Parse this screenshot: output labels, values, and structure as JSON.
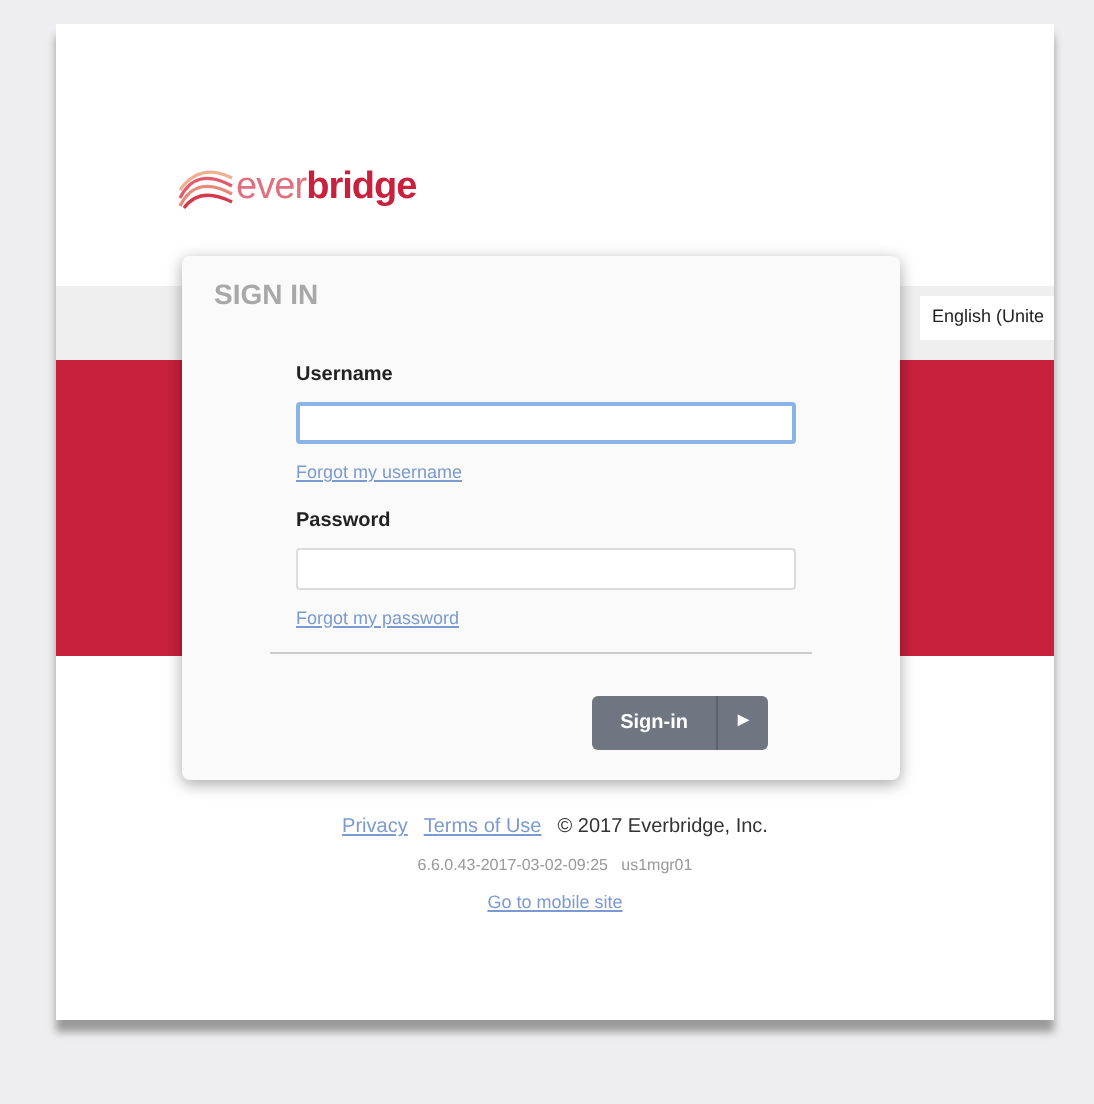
{
  "logo": {
    "text": "ever**bridge**"
  },
  "language": {
    "value": "English (Unite"
  },
  "sign_in": {
    "title": "SIGN IN",
    "username": {
      "label": "Username",
      "focused": true
    },
    "forgot_username": "Forgot my username",
    "password": {
      "label": "Password",
      "focused": false
    },
    "forgot_password": "Forgot my password",
    "button": {
      "label": "Sign-in",
      "arrow": "▶"
    }
  },
  "footer": {
    "links": [
      "Privacy",
      "Terms of Use"
    ],
    "copyright": "© 2017 Everbridge, Inc.",
    "version": "6.6.0.43-2017-03-02-09:25   us1mgr01",
    "mobile_link": "Go to mobile site"
  }
}
